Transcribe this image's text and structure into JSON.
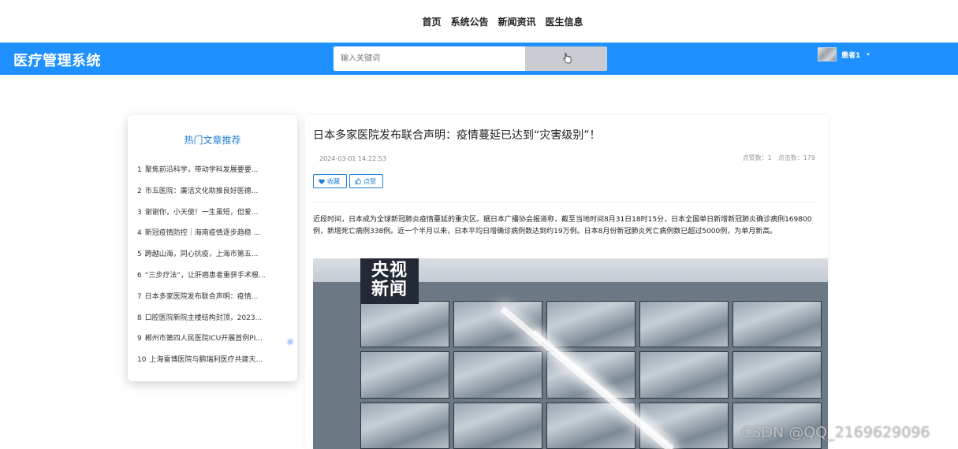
{
  "topnav": {
    "items": [
      "首页",
      "系统公告",
      "新闻资讯",
      "医生信息"
    ]
  },
  "header": {
    "brand": "医疗管理系统",
    "search_placeholder": "输入关键词",
    "user_name": "患者1",
    "caret": "▾",
    "bg_color": "#1E90FF"
  },
  "sidebar": {
    "title": "热门文章推荐",
    "items": [
      {
        "num": "1",
        "label": "聚焦前沿科学，带动学科发展要要..."
      },
      {
        "num": "2",
        "label": "市五医院：廉洁文化助推良好医德..."
      },
      {
        "num": "3",
        "label": "谢谢你，小天使！一生虽短，但爱..."
      },
      {
        "num": "4",
        "label": "新冠疫情防控｜海南疫情逐步趋稳 ..."
      },
      {
        "num": "5",
        "label": "跨越山海，同心抗疫，上海市第五..."
      },
      {
        "num": "6",
        "label": "“三步疗法”，让肝癌患者重获手术根..."
      },
      {
        "num": "7",
        "label": "日本多家医院发布联合声明：疫情..."
      },
      {
        "num": "8",
        "label": "口腔医院新院主楼结构封顶，2023..."
      },
      {
        "num": "9",
        "label": "郴州市第四人民医院ICU开展首例PI..."
      },
      {
        "num": "10",
        "label": "上海雷博医院与鹏瑞利医疗共建天..."
      }
    ]
  },
  "article": {
    "title": "日本多家医院发布联合声明：疫情蔓延已达到“灾害级别”！",
    "date": "2024-03-01 14:22:53",
    "likes_text": "点赞数：1",
    "clicks_text": "点击数：179",
    "favorite_label": "收藏",
    "like_label": "点赞",
    "body": "近段时间，日本成为全球新冠肺炎疫情蔓延的重灾区。据日本广播协会报道称，截至当地时间8月31日18时15分，日本全国单日新增新冠肺炎确诊病例169800例，新增死亡病例338例。近一个半月以来，日本平均日增确诊病例数达到约19万例。日本8月份新冠肺炎死亡病例数已超过5000例，为单月新高。",
    "image_logo_line1": "央视",
    "image_logo_line2": "新闻"
  },
  "watermark": "CSDN @QQ_2169629096"
}
